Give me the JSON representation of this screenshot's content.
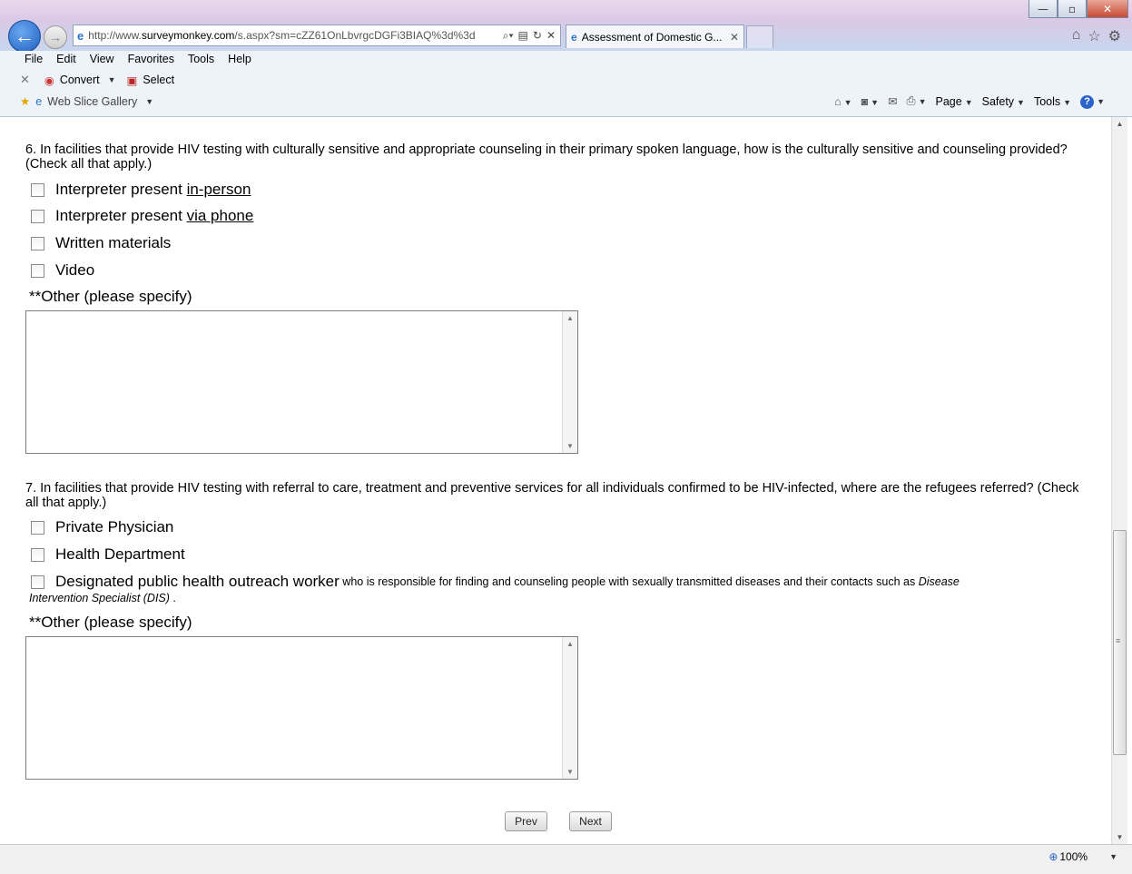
{
  "browser": {
    "url_prefix": "http://www.",
    "url_domain": "surveymonkey.com",
    "url_rest": "/s.aspx?sm=cZZ61OnLbvrgcDGFi3BIAQ%3d%3d",
    "tab_title": "Assessment of Domestic G...",
    "menu": [
      "File",
      "Edit",
      "View",
      "Favorites",
      "Tools",
      "Help"
    ],
    "convert_label": "Convert",
    "select_label": "Select",
    "web_slice_label": "Web Slice Gallery",
    "page_menu": "Page",
    "safety_menu": "Safety",
    "tools_menu": "Tools",
    "zoom": "100%"
  },
  "q6": {
    "text": "6. In facilities that provide HIV testing with culturally sensitive and appropriate counseling in their primary spoken language, how is the culturally sensitive and counseling provided? (Check all that apply.)",
    "opt1_pre": "Interpreter present ",
    "opt1_u": "in-person",
    "opt2_pre": "Interpreter present ",
    "opt2_u": "via phone",
    "opt3": "Written materials",
    "opt4": "Video",
    "other_label": "**Other (please specify)"
  },
  "q7": {
    "text": "7. In facilities that provide HIV testing with referral to care, treatment and preventive services for all individuals confirmed to be HIV-infected, where are the refugees referred? (Check all that apply.)",
    "opt1": "Private Physician",
    "opt2": "Health Department",
    "opt3_main": "Designated public health outreach worker",
    "opt3_small": " who is responsible for finding and counseling people with sexually transmitted diseases and their contacts such as ",
    "opt3_italic1": "Disease",
    "opt3_italic2": "Intervention Specialist (DIS)",
    "opt3_end": " .",
    "other_label": "**Other (please specify)"
  },
  "nav": {
    "prev": "Prev",
    "next": "Next"
  }
}
